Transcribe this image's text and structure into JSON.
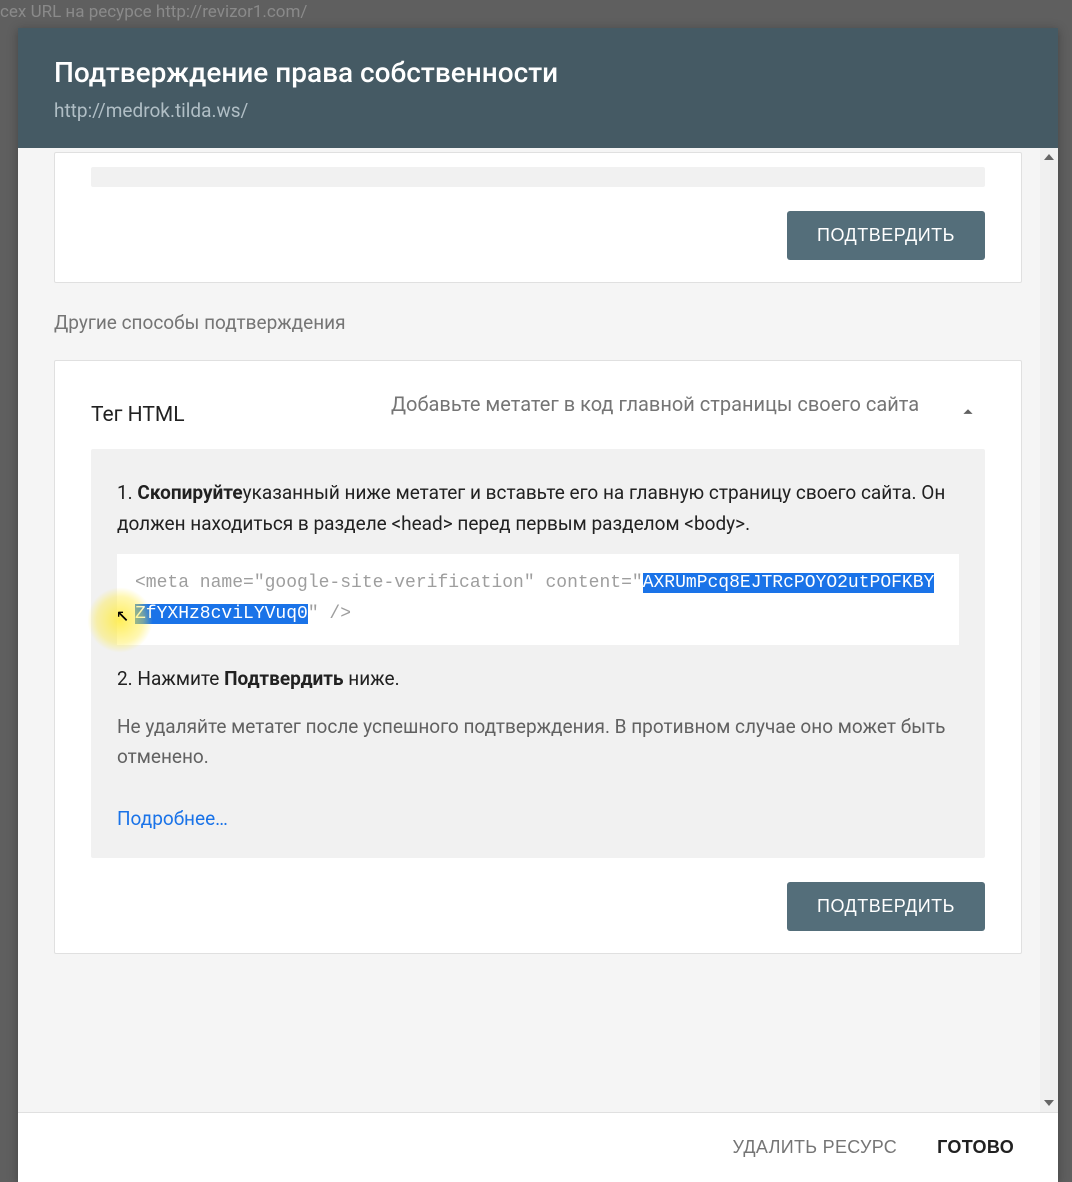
{
  "background_text": "сех URL на ресурсе http://revizor1.com/",
  "dialog": {
    "title": "Подтверждение права собственности",
    "subtitle": "http://medrok.tilda.ws/",
    "confirm_button": "ПОДТВЕРДИТЬ",
    "other_methods_label": "Другие способы подтверждения",
    "html_tag": {
      "title": "Тег HTML",
      "description": "Добавьте метатег в код главной страницы своего сайта",
      "step1_bold": "Скопируйте",
      "step1_rest": "указанный ниже метатег и вставьте его на главную страницу своего сайта. Он должен находиться в разделе <head> перед первым разделом <body>.",
      "code_prefix": "<meta name=\"google-site-verification\" content=\"",
      "code_selected": "AXRUmPcq8EJTRcPOYO2utPOFKBYZfYXHz8cviLYVuq0",
      "code_suffix": "\"  />",
      "step2_prefix": "2. Нажмите ",
      "step2_bold": "Подтвердить",
      "step2_suffix": " ниже.",
      "warning": "Не удаляйте метатег после успешного подтверждения. В противном случае оно может быть отменено.",
      "learn_more": "Подробнее…"
    },
    "footer": {
      "delete": "УДАЛИТЬ РЕСУРС",
      "done": "ГОТОВО"
    }
  }
}
